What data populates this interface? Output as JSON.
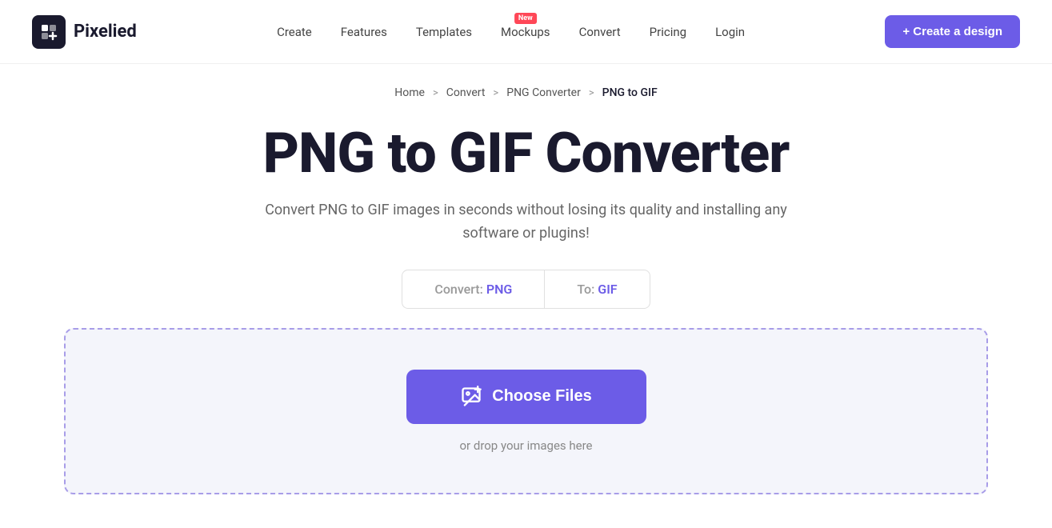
{
  "header": {
    "logo_text": "Pixelied",
    "nav": {
      "create": "Create",
      "features": "Features",
      "templates": "Templates",
      "mockups": "Mockups",
      "mockups_badge": "New",
      "convert": "Convert",
      "pricing": "Pricing",
      "login": "Login"
    },
    "create_button": "+ Create a design"
  },
  "breadcrumb": {
    "home": "Home",
    "sep1": ">",
    "convert": "Convert",
    "sep2": ">",
    "png_converter": "PNG Converter",
    "sep3": ">",
    "current": "PNG to GIF"
  },
  "hero": {
    "title": "PNG to GIF Converter",
    "subtitle": "Convert PNG to GIF images in seconds without losing its quality and installing any software or plugins!"
  },
  "converter_tabs": {
    "from_label": "Convert:",
    "from_value": "PNG",
    "to_label": "To:",
    "to_value": "GIF"
  },
  "drop_zone": {
    "choose_files": "Choose Files",
    "drop_hint": "or drop your images here"
  },
  "colors": {
    "accent": "#6c5ce7",
    "badge_red": "#ff4757",
    "text_dark": "#1a1a2e",
    "text_muted": "#666666",
    "border_dashed": "#a89de8",
    "zone_bg": "#f4f5fb"
  }
}
